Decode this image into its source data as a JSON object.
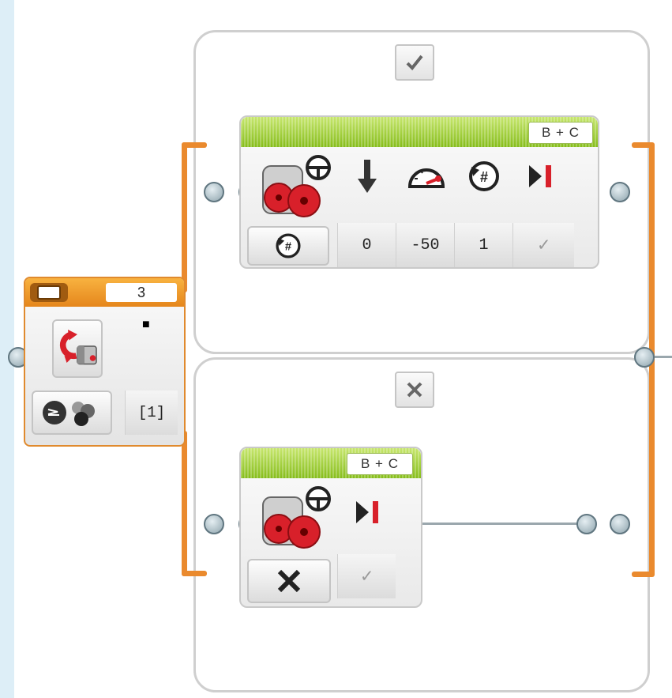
{
  "switch_block": {
    "case_value": "3",
    "output_marker": "■",
    "port_value": "[1]",
    "icon": "color-sensor-switch-icon",
    "mode_icon": "color-compare-icon"
  },
  "cases": [
    {
      "tab_icon": "checkmark-icon",
      "motor_block": {
        "ports": "B + C",
        "mode_icon": "rotations-icon",
        "param_icons": [
          "steering-arrow-icon",
          "speed-gauge-icon",
          "rotations-icon",
          "brake-icon"
        ],
        "params": [
          "0",
          "-50",
          "1",
          "✓"
        ]
      }
    },
    {
      "tab_icon": "cross-icon",
      "motor_block": {
        "ports": "B + C",
        "mode_icon": "off-cross-icon",
        "param_icons": [
          "brake-icon"
        ],
        "params": [
          "✓"
        ]
      }
    }
  ],
  "colors": {
    "accent_orange": "#ea8a2e",
    "motor_green": "#86bd1b",
    "frame_gray": "#cfcfcf"
  }
}
